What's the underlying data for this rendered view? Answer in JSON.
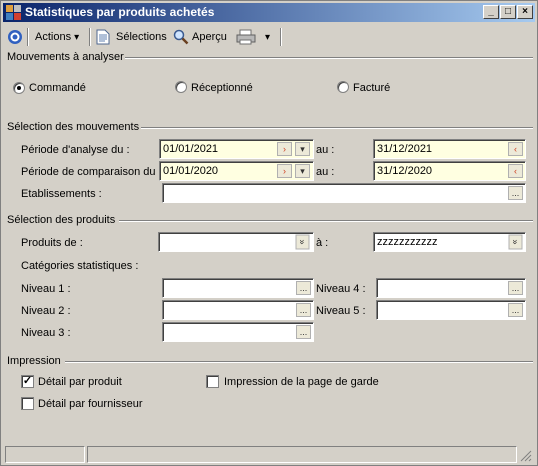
{
  "window": {
    "title": "Statistiques par produits achetés"
  },
  "toolbar": {
    "actions": "Actions",
    "selections": "Sélections",
    "apercu": "Aperçu"
  },
  "mouvements": {
    "header": "Mouvements à analyser",
    "options": [
      "Commandé",
      "Réceptionné",
      "Facturé"
    ],
    "selected": "Commandé"
  },
  "selection_mouvements": {
    "header": "Sélection des mouvements",
    "periode_analyse_label": "Période d'analyse du :",
    "periode_analyse_from": "01/01/2021",
    "periode_analyse_to": "31/12/2021",
    "periode_comparaison_label": "Période de comparaison du :",
    "periode_comparaison_from": "01/01/2020",
    "periode_comparaison_to": "31/12/2020",
    "au_label": "au :",
    "etablissements_label": "Etablissements :",
    "etablissements_value": ""
  },
  "selection_produits": {
    "header": "Sélection des produits",
    "produits_de_label": "Produits de :",
    "produits_de_value": "",
    "a_label": "à :",
    "produits_a_value": "zzzzzzzzzzz",
    "categories_label": "Catégories statistiques :",
    "niveau1_label": "Niveau 1 :",
    "niveau2_label": "Niveau 2 :",
    "niveau3_label": "Niveau 3 :",
    "niveau4_label": "Niveau 4 :",
    "niveau5_label": "Niveau 5 :"
  },
  "impression": {
    "header": "Impression",
    "detail_produit_label": "Détail par produit",
    "detail_produit_checked": true,
    "detail_fournisseur_label": "Détail par fournisseur",
    "detail_fournisseur_checked": false,
    "page_garde_label": "Impression de la page de garde",
    "page_garde_checked": false
  },
  "icons": {
    "ellipsis": "...",
    "dropdown": "▾",
    "double_chevron": "»",
    "check": "✓"
  },
  "colors": {
    "title_start": "#0a246a",
    "title_end": "#a6caf0",
    "date_field": "#ffffe1",
    "window_bg": "#d4d0c8"
  }
}
